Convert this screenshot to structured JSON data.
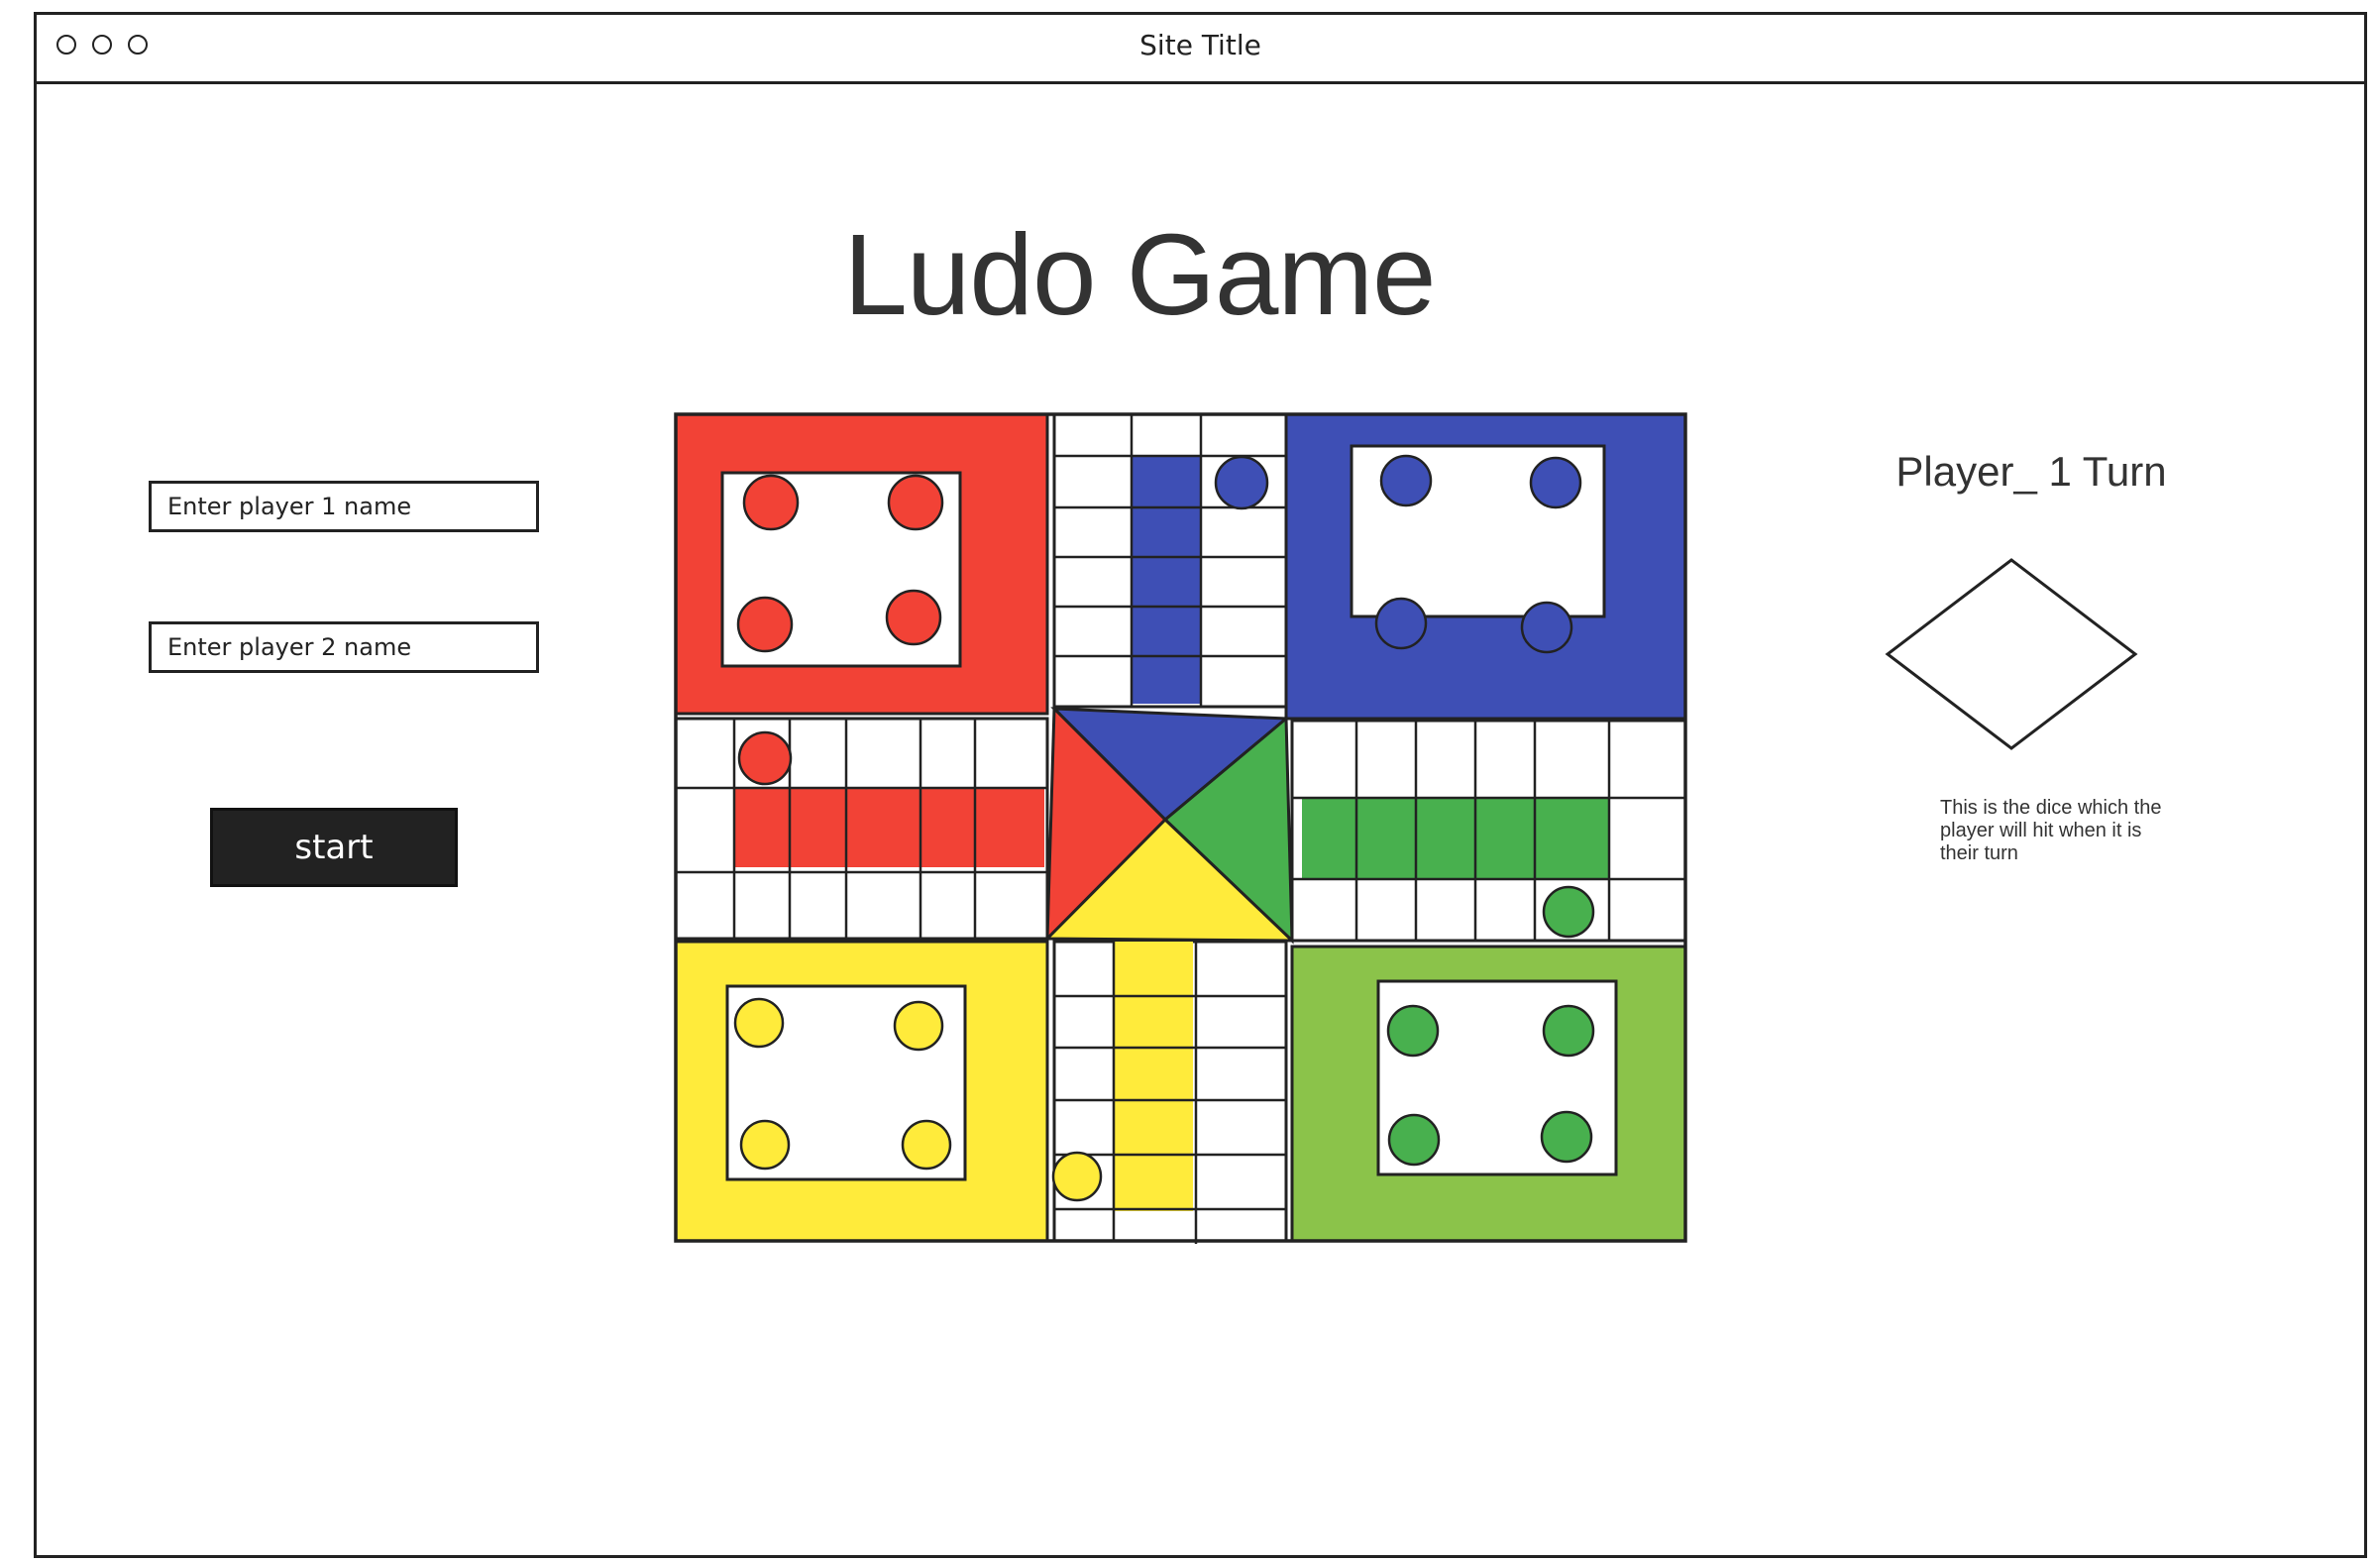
{
  "window": {
    "title": "Site Title",
    "controls": [
      "circle-icon",
      "circle-icon",
      "circle-icon"
    ]
  },
  "page": {
    "title": "Ludo Game"
  },
  "players": {
    "player1_placeholder": "Enter player 1 name",
    "player2_placeholder": "Enter player 2 name",
    "start_label": "start"
  },
  "turn": {
    "label": "Player_ 1 Turn"
  },
  "dice": {
    "icon": "dice-icon",
    "note": "This is the dice which the player will hit when it is their turn"
  },
  "board": {
    "colors": {
      "red": "#f24236",
      "blue": "#3e4fb5",
      "green": "#48b04e",
      "light_green": "#8bc34a",
      "yellow": "#ffeb3b",
      "outline": "#222222"
    }
  }
}
